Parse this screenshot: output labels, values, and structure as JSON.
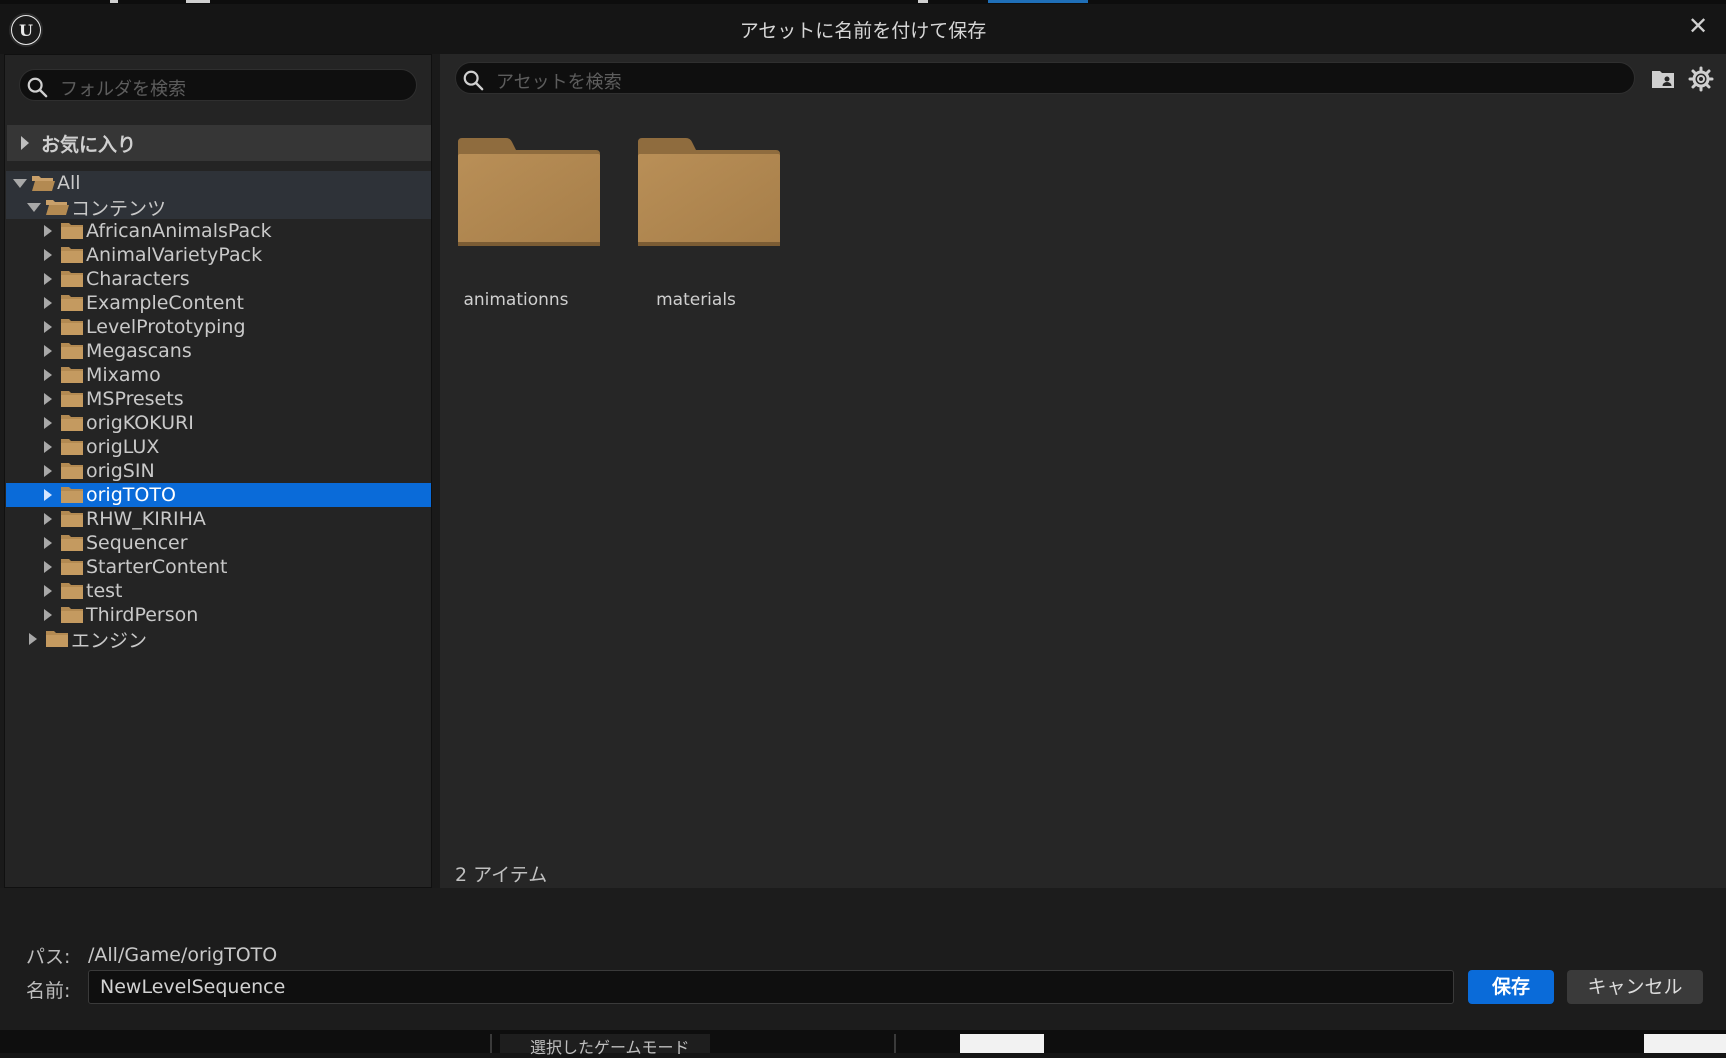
{
  "window": {
    "title": "アセットに名前を付けて保存",
    "close_symbol": "✕",
    "logo_letter": "U"
  },
  "left": {
    "search_placeholder": "フォルダを検索",
    "favorites_label": "お気に入り",
    "tree": {
      "root": "All",
      "content": "コンテンツ",
      "folders": [
        "AfricanAnimalsPack",
        "AnimalVarietyPack",
        "Characters",
        "ExampleContent",
        "LevelPrototyping",
        "Megascans",
        "Mixamo",
        "MSPresets",
        "origKOKURI",
        "origLUX",
        "origSIN",
        "origTOTO",
        "RHW_KIRIHA",
        "Sequencer",
        "StarterContent",
        "test",
        "ThirdPerson"
      ],
      "selected_folder": "origTOTO",
      "engine": "エンジン"
    }
  },
  "right": {
    "search_placeholder": "アセットを検索",
    "tiles": [
      "animationns",
      "materials"
    ],
    "item_count": "2 アイテム"
  },
  "bottom": {
    "path_label": "パス:",
    "path_value": "/All/Game/origTOTO",
    "name_label": "名前:",
    "name_value": "NewLevelSequence",
    "save_label": "保存",
    "cancel_label": "キャンセル"
  },
  "under_strip": {
    "mode_label": "選択したゲームモード"
  },
  "colors": {
    "accent": "#0a6bd9",
    "folder": "#b38a52",
    "panel": "#242424",
    "background": "#1a1a1a"
  },
  "icons": {
    "search": "search-icon",
    "folder": "folder-icon",
    "settings": "gear-icon",
    "folder_user": "folder-person-icon",
    "close": "close-icon"
  }
}
